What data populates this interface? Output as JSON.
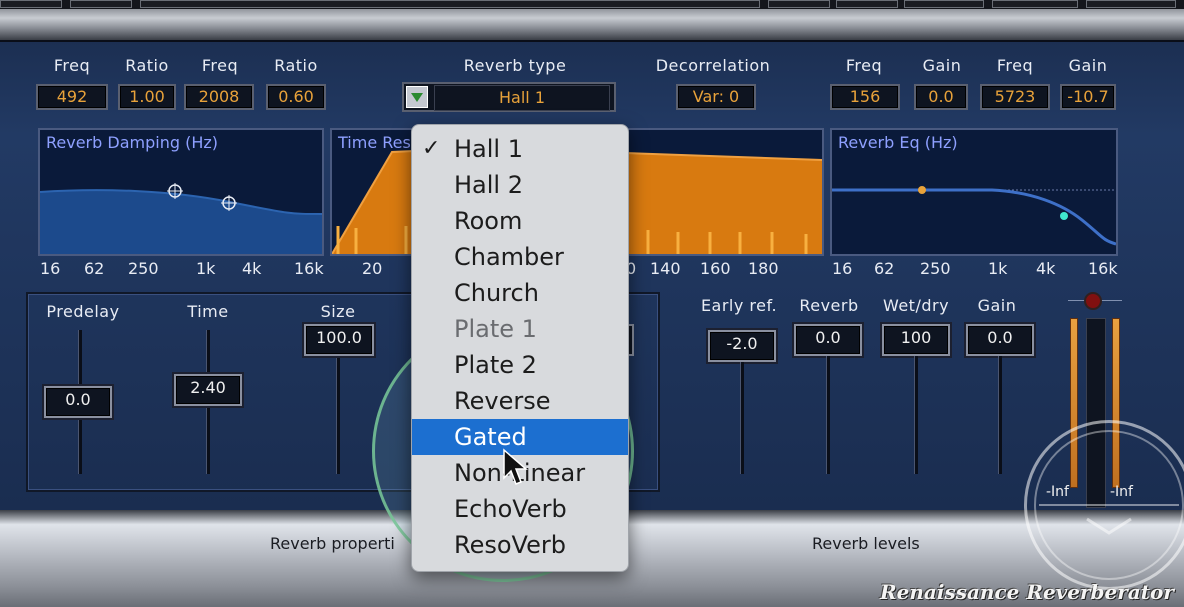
{
  "top_params": [
    {
      "label": "Freq",
      "value": "492"
    },
    {
      "label": "Ratio",
      "value": "1.00"
    },
    {
      "label": "Freq",
      "value": "2008"
    },
    {
      "label": "Ratio",
      "value": "0.60"
    }
  ],
  "reverb_type": {
    "label": "Reverb type",
    "value": "Hall 1"
  },
  "decorrelation": {
    "label": "Decorrelation",
    "value": "Var: 0"
  },
  "eq_params": [
    {
      "label": "Freq",
      "value": "156"
    },
    {
      "label": "Gain",
      "value": "0.0"
    },
    {
      "label": "Freq",
      "value": "5723"
    },
    {
      "label": "Gain",
      "value": "-10.7"
    }
  ],
  "graphs": {
    "damping": {
      "title": "Reverb Damping (Hz)",
      "ticks": [
        "16",
        "62",
        "250",
        "1k",
        "4k",
        "16k"
      ]
    },
    "time_response": {
      "title": "Time Res",
      "ticks": [
        "20",
        "0",
        "140",
        "160",
        "180"
      ]
    },
    "eq": {
      "title": "Reverb Eq (Hz)",
      "ticks": [
        "16",
        "62",
        "250",
        "1k",
        "4k",
        "16k"
      ]
    }
  },
  "reverb_properties": {
    "predelay": {
      "label": "Predelay",
      "value": "0.0"
    },
    "time": {
      "label": "Time",
      "value": "2.40"
    },
    "size": {
      "label": "Size",
      "value": "100.0"
    }
  },
  "reverb_levels": [
    {
      "label": "Early ref.",
      "value": "-2.0"
    },
    {
      "label": "Reverb",
      "value": "0.0"
    },
    {
      "label": "Wet/dry",
      "value": "100"
    },
    {
      "label": "Gain",
      "value": "0.0"
    }
  ],
  "meter_labels": [
    "-Inf",
    "-Inf"
  ],
  "sections": {
    "properties": "Reverb properti",
    "levels": "Reverb levels"
  },
  "brand": "Renaissance Reverberator",
  "menu": {
    "items": [
      "Hall 1",
      "Hall 2",
      "Room",
      "Chamber",
      "Church",
      "Plate 1",
      "Plate 2",
      "Reverse",
      "Gated",
      "Non-Linear",
      "EchoVerb",
      "ResoVerb"
    ],
    "checked": "Hall 1",
    "highlighted": "Gated"
  },
  "colors": {
    "accent": "#e8a23a",
    "menu_highlight": "#1c6fd0",
    "panel": "#1c2f52",
    "graph_label": "#8ea0ff"
  }
}
